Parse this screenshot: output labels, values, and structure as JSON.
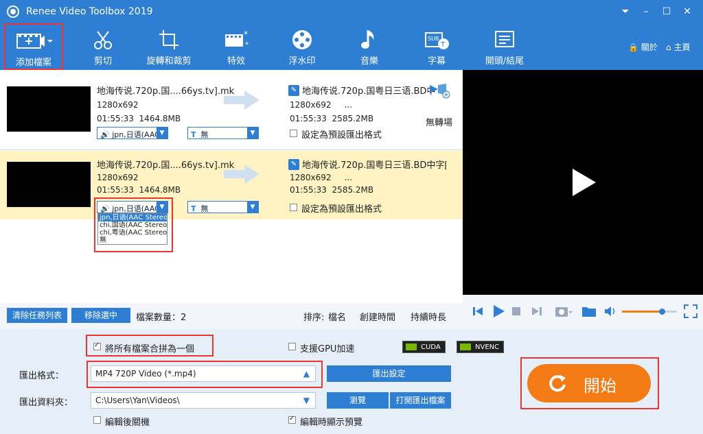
{
  "window": {
    "title": "Renee Video Toolbox 2019"
  },
  "toolbar": {
    "items": [
      {
        "label": "添加檔案",
        "icon": "add-file-icon"
      },
      {
        "label": "剪切",
        "icon": "scissors-icon"
      },
      {
        "label": "旋轉和裁剪",
        "icon": "rotate-crop-icon"
      },
      {
        "label": "特效",
        "icon": "effects-icon"
      },
      {
        "label": "浮水印",
        "icon": "watermark-icon"
      },
      {
        "label": "音樂",
        "icon": "music-icon"
      },
      {
        "label": "字幕",
        "icon": "subtitle-icon"
      },
      {
        "label": "開頭/結尾",
        "icon": "intro-outro-icon"
      }
    ],
    "about_label": "關於",
    "home_label": "主頁"
  },
  "files": [
    {
      "name": "地海传说.720p.国....66ys.tv].mk",
      "resolution": "1280x692",
      "duration": "01:55:33",
      "size": "1464.8MB",
      "out_name": "地海传说.720p.国粤日三语.BD中",
      "out_resolution": "1280x692",
      "out_dots": "...",
      "out_duration": "01:55:33",
      "out_size": "2585.2MB",
      "transition": "無轉場",
      "audio": "jpn,日语(AAC",
      "subtitle": "無",
      "default_label": "設定為預設匯出格式"
    },
    {
      "name": "地海传说.720p.国....66ys.tv].mk",
      "resolution": "1280x692",
      "duration": "01:55:33",
      "size": "1464.8MB",
      "out_name": "地海传说.720p.国粤日三语.BD中字[",
      "out_resolution": "1280x692",
      "out_dots": "...",
      "out_duration": "01:55:33",
      "out_size": "2585.2MB",
      "audio": "jpn,日语(AAC",
      "subtitle": "無",
      "default_label": "設定為預設匯出格式"
    }
  ],
  "audio_options": [
    "jpn,日语(AAC Stereo",
    "chi,国语(AAC Stereo",
    "chi,粤语(AAC Stereo",
    "無"
  ],
  "list_footer": {
    "clear_label": "清除任務列表",
    "remove_label": "移除選中",
    "count_label": "檔案數量：",
    "count": "2",
    "sort_label": "排序:",
    "sort_name": "檔名",
    "sort_created": "創建時間",
    "sort_duration": "持續時長"
  },
  "bottom": {
    "merge_label": "將所有檔案合拼為一個",
    "merge_checked": true,
    "gpu_label": "支援GPU加速",
    "cuda_label": "CUDA",
    "nvenc_label": "NVENC",
    "format_label": "匯出格式：",
    "format_value": "MP4 720P Video (*.mp4)",
    "export_settings_label": "匯出設定",
    "folder_label": "匯出資料夾：",
    "folder_value": "C:\\Users\\Yan\\Videos\\",
    "browse_label": "瀏覽",
    "open_folder_label": "打開匯出檔案",
    "shutdown_label": "編輯後關機",
    "preview_label": "編輯時顯示預覽",
    "preview_checked": true,
    "start_label": "開始"
  },
  "player": {
    "volume": 0.72
  },
  "colors": {
    "primary": "#2e7fd4",
    "accent": "#f47b13",
    "highlight": "#fff3c4",
    "annotation": "#e33333"
  }
}
